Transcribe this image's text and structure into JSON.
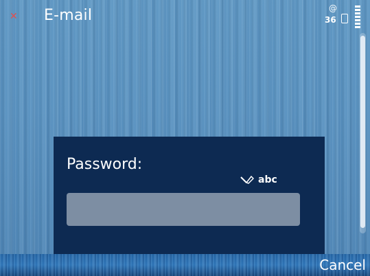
{
  "app": {
    "title": "E-mail",
    "close_icon": "close-icon"
  },
  "status": {
    "at_symbol": "@",
    "network_label": "36",
    "icons": [
      "at-icon",
      "network-icon",
      "lock-icon",
      "signal-icon"
    ]
  },
  "dialog": {
    "label": "Password:",
    "input_mode": "abc",
    "field_value": "",
    "input_mode_icon": "pen-icon"
  },
  "softkeys": {
    "right": "Cancel"
  },
  "colors": {
    "dialog_bg": "#0d2a52",
    "field_bg": "#7d8ea3",
    "accent_red": "#e05050"
  }
}
